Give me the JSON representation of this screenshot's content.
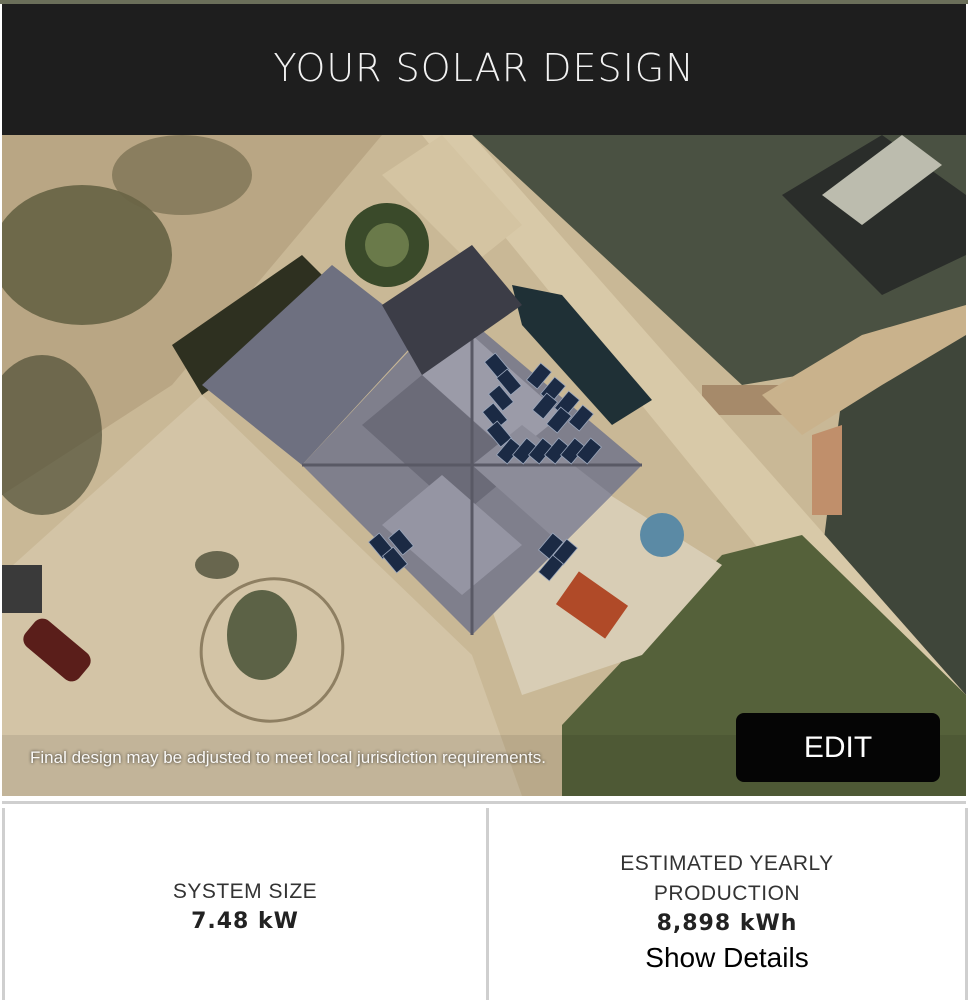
{
  "header": {
    "title": "YOUR SOLAR DESIGN"
  },
  "map": {
    "disclaimer": "Final design may be adjusted to meet local jurisdiction requirements.",
    "edit_label": "EDIT"
  },
  "stats": {
    "system_size": {
      "label": "SYSTEM SIZE",
      "value": "7.48 kW"
    },
    "yearly_production": {
      "label_line1": "ESTIMATED YEARLY",
      "label_line2": "PRODUCTION",
      "value": "8,898 kWh",
      "link": "Show Details"
    }
  },
  "colors": {
    "header_bg": "#1e1e1e",
    "button_bg": "#050505",
    "panel": "#1b2a44",
    "roof": "#7f7f8c"
  }
}
